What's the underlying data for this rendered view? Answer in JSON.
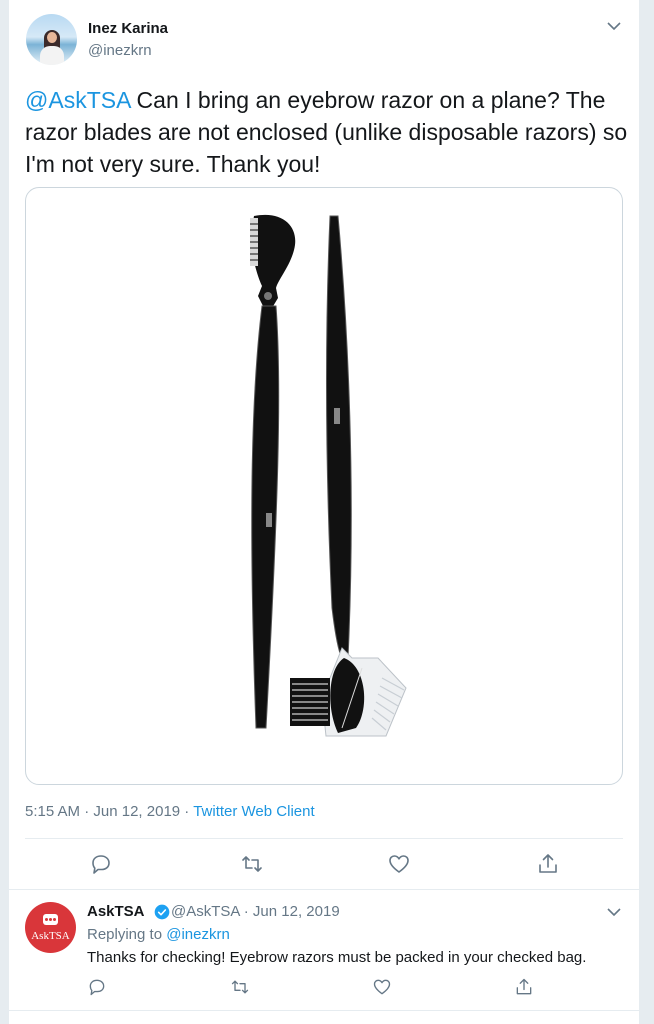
{
  "tweet": {
    "author_name": "Inez Karina",
    "author_handle": "@inezkrn",
    "mention": "@AskTSA",
    "text": " Can I bring an eyebrow razor on a plane? The razor blades are not enclosed (unlike disposable razors) so I'm not very sure. Thank you!",
    "time": "5:15 AM",
    "sep1": " · ",
    "date": "Jun 12, 2019",
    "sep2": " · ",
    "client": "Twitter Web Client",
    "actions": [
      "reply-icon",
      "retweet-icon",
      "like-icon",
      "share-icon"
    ]
  },
  "reply": {
    "author_name": "AskTSA",
    "author_handle": "@AskTSA",
    "sep": " · ",
    "date": "Jun 12, 2019",
    "replying_label": "Replying to ",
    "replying_to": "@inezkrn",
    "text": "Thanks for checking! Eyebrow razors must be packed in your checked bag.",
    "avatar_text": "AskTSA",
    "actions": [
      "reply-icon",
      "retweet-icon",
      "like-icon",
      "share-icon"
    ]
  },
  "colors": {
    "link": "#1b95e0",
    "secondary_text": "#657786",
    "tsa_brand": "#d9363a",
    "verified": "#1da1f2"
  }
}
